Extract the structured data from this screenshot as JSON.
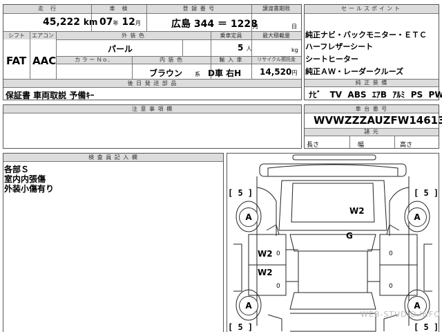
{
  "top": {
    "mileage_label": "走　行",
    "mileage_value": "45,222",
    "mileage_unit": "km",
    "inspection_label": "車　検",
    "inspection_year": "07",
    "inspection_year_unit": "年",
    "inspection_month": "12",
    "inspection_month_unit": "月",
    "reg_label": "登 録 番 号",
    "reg_value": "広島 344 ＝ 1228",
    "transfer_label": "譲渡書期限",
    "transfer_month_unit": "月",
    "transfer_day_unit": "日"
  },
  "row2": {
    "shift_label": "シフト",
    "shift_value": "FAT",
    "ac_label": "エアコン",
    "ac_value": "AAC",
    "ext_color_label": "外 装 色",
    "ext_color_value": "パール",
    "color_no_label": "カ ラ ー Ｎｏ．",
    "int_color_label": "内 装 色",
    "int_color_value": "ブラウン",
    "int_color_unit": "系",
    "capacity_label": "乗車定員",
    "capacity_value": "5",
    "capacity_unit": "人",
    "max_load_label": "最大積載量",
    "max_load_unit": "kg",
    "import_label": "輸 入 車",
    "import_value": "D車 右H",
    "recycle_label": "リサイクル預託金",
    "recycle_value": "14,520",
    "recycle_unit": "円"
  },
  "docs": {
    "header": "後 日 発 送 部 品",
    "value": "保証書 車両取説 予備ｷｰ"
  },
  "sales": {
    "header": "セールスポイント",
    "items": [
      "純正ナビ・バックモニター・ＥＴＣ",
      "ハーフレザーシート",
      "シートヒーター",
      "純正ＡＷ・レーダークルーズ"
    ]
  },
  "equipment": {
    "header": "純 正 装 備",
    "items": [
      "ﾅﾋﾞ",
      "TV",
      "ABS",
      "ｴｱB",
      "ｱﾙﾐ",
      "PS",
      "PW"
    ]
  },
  "notes": {
    "header": "注 意 事 項 欄"
  },
  "chassis": {
    "header": "車 台 番 号",
    "value": "WVWZZZAUZFW146131",
    "dims_header": "諸 元",
    "length_label": "長さ",
    "width_label": "幅",
    "height_label": "高さ"
  },
  "inspector": {
    "header": "検 査 員 記 入 欄",
    "lines": [
      "各部Ｓ",
      "室内内張傷",
      "外装小傷有り"
    ]
  },
  "diagram": {
    "tire_labels": [
      "[ 5 ]",
      "[ 5 ]",
      "[ 5 ]",
      "[ 5 ]"
    ],
    "wheel_marks": [
      "A",
      "A",
      "A",
      "A"
    ],
    "damage": {
      "hood": "W2",
      "roof": "G",
      "door_front_left": "W2",
      "door_rear_left": "W2"
    },
    "door_zero": "0"
  },
  "watermark": "WEB-STUDIO.INFO"
}
